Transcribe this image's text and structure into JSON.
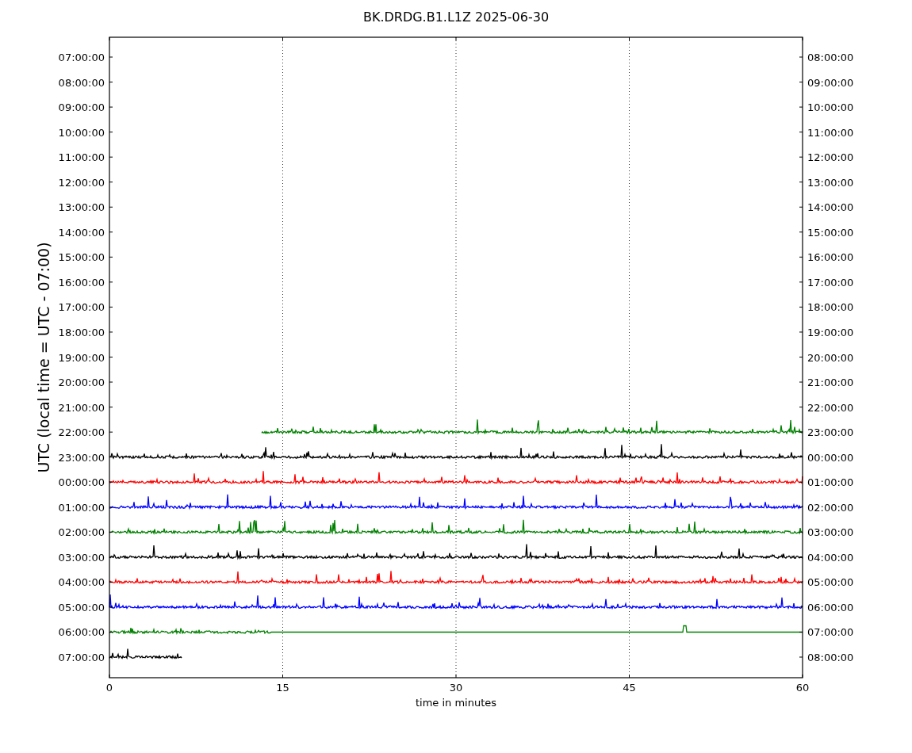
{
  "title": "BK.DRDG.B1.L1Z 2025-06-30",
  "plot": {
    "ylabel": "UTC (local time = UTC - 07:00)",
    "xlabel": "time in minutes",
    "left_labels": [
      "07:00:00",
      "08:00:00",
      "09:00:00",
      "10:00:00",
      "11:00:00",
      "12:00:00",
      "13:00:00",
      "14:00:00",
      "15:00:00",
      "16:00:00",
      "17:00:00",
      "18:00:00",
      "19:00:00",
      "20:00:00",
      "21:00:00",
      "22:00:00",
      "23:00:00",
      "00:00:00",
      "01:00:00",
      "02:00:00",
      "03:00:00",
      "04:00:00",
      "05:00:00",
      "06:00:00",
      "07:00:00"
    ],
    "right_labels": [
      "08:00:00",
      "09:00:00",
      "10:00:00",
      "11:00:00",
      "12:00:00",
      "13:00:00",
      "14:00:00",
      "15:00:00",
      "16:00:00",
      "17:00:00",
      "18:00:00",
      "19:00:00",
      "20:00:00",
      "21:00:00",
      "22:00:00",
      "23:00:00",
      "00:00:00",
      "01:00:00",
      "02:00:00",
      "03:00:00",
      "04:00:00",
      "05:00:00",
      "06:00:00",
      "07:00:00",
      "08:00:00"
    ],
    "xticks": [
      "0",
      "15",
      "30",
      "45",
      "60"
    ],
    "traces": [
      {
        "color": "#008000"
      },
      {
        "color": "#000000"
      },
      {
        "color": "#ff0000"
      },
      {
        "color": "#0000ff"
      },
      {
        "color": "#008000"
      },
      {
        "color": "#000000"
      },
      {
        "color": "#ff0000"
      },
      {
        "color": "#0000ff"
      },
      {
        "color": "#008000"
      },
      {
        "color": "#000000"
      }
    ]
  }
}
